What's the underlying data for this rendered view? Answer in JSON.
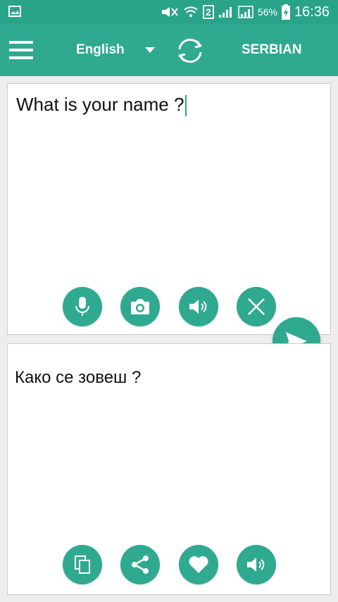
{
  "status_bar": {
    "battery_percent": "56%",
    "time": "16:36",
    "sim_badge": "2"
  },
  "toolbar": {
    "source_language": "English",
    "target_language": "SERBIAN"
  },
  "input": {
    "text": "What is your name ?"
  },
  "output": {
    "text": "Како се зовеш ?"
  },
  "icons": {
    "menu": "menu-icon",
    "swap": "swap-languages-icon",
    "mic": "microphone-icon",
    "camera": "camera-icon",
    "speak": "speaker-icon",
    "clear": "close-icon",
    "send": "send-icon",
    "copy": "copy-icon",
    "share": "share-icon",
    "favorite": "heart-icon"
  },
  "colors": {
    "accent": "#2fa990",
    "status_bar": "#2aa38b",
    "background": "#ededed"
  }
}
